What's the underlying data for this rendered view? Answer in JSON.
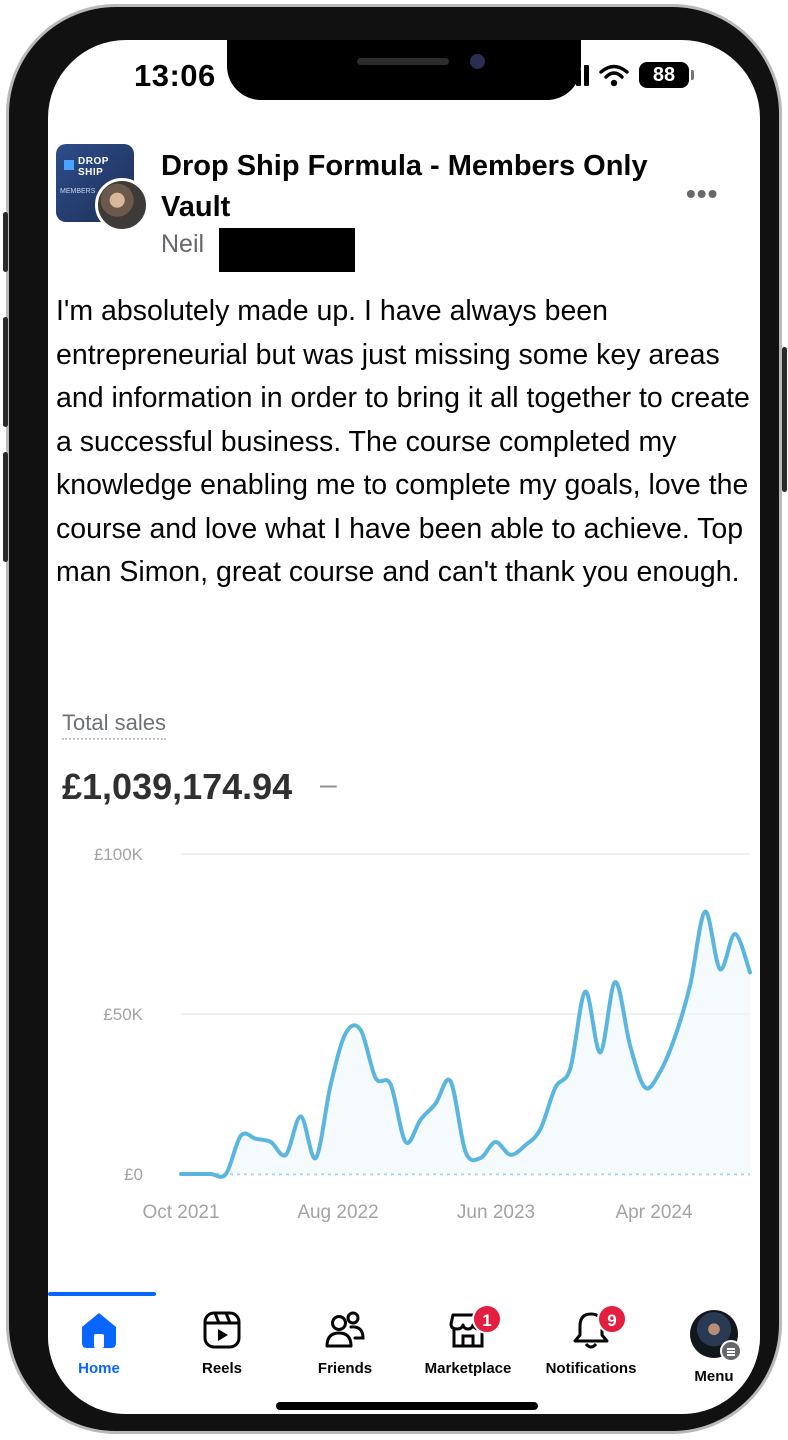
{
  "status_bar": {
    "time": "13:06",
    "battery": "88"
  },
  "post": {
    "group_name": "Drop Ship Formula - Members Only Vault",
    "author": "Neil",
    "more_label": "•••",
    "text": "I'm absolutely made up. I have always been entrepreneurial but was just missing some key areas and information in order to bring it all together to create a successful business. The course completed my knowledge enabling me to complete my goals, love the course and love what I have been able to achieve. Top man Simon, great course and can't thank you enough.",
    "group_logo_text": "DROP SHIP",
    "group_logo_subtext": "MEMBERS"
  },
  "sales": {
    "label": "Total sales",
    "value": "£1,039,174.94",
    "change": "–"
  },
  "chart_data": {
    "type": "line",
    "title": "",
    "xlabel": "",
    "ylabel": "",
    "y_ticks": [
      "£100K",
      "£50K",
      "£0"
    ],
    "y_tick_values": [
      100000,
      50000,
      0
    ],
    "x_ticks": [
      "Oct 2021",
      "Aug 2022",
      "Jun 2023",
      "Apr 2024"
    ],
    "ylim": [
      0,
      100000
    ],
    "line_color": "#5bb6df",
    "grid": true,
    "series": [
      {
        "values": [
          0,
          0,
          0,
          0,
          12000,
          11000,
          10000,
          6000,
          18000,
          5000,
          28000,
          44000,
          45000,
          30000,
          28000,
          10000,
          17000,
          22000,
          29000,
          7000,
          5000,
          10000,
          6000,
          9000,
          14000,
          27000,
          33000,
          57000,
          38000,
          60000,
          40000,
          27000,
          32000,
          43000,
          59000,
          82000,
          64000,
          75000,
          63000
        ]
      }
    ]
  },
  "tabs": [
    {
      "label": "Home",
      "icon": "home-icon",
      "active": true
    },
    {
      "label": "Reels",
      "icon": "reels-icon"
    },
    {
      "label": "Friends",
      "icon": "friends-icon"
    },
    {
      "label": "Marketplace",
      "icon": "marketplace-icon",
      "badge": "1"
    },
    {
      "label": "Notifications",
      "icon": "bell-icon",
      "badge": "9"
    },
    {
      "label": "Menu",
      "icon": "profile-avatar"
    }
  ]
}
